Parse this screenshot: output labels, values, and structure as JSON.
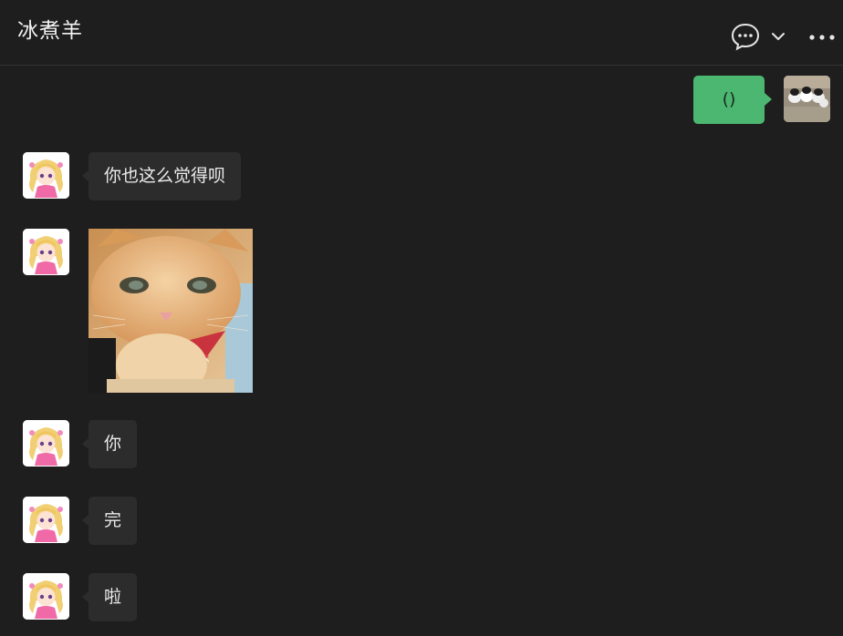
{
  "header": {
    "title": "冰煮羊",
    "icons": [
      "chat-bubble-icon",
      "chevron-down-icon",
      "more-options-icon"
    ]
  },
  "messages": [
    {
      "side": "right",
      "type": "text",
      "text": "()"
    },
    {
      "side": "left",
      "type": "text",
      "text": "你也这么觉得呗"
    },
    {
      "side": "left",
      "type": "image",
      "image": "orange cat with red checkered bowtie"
    },
    {
      "side": "left",
      "type": "text",
      "text": "你"
    },
    {
      "side": "left",
      "type": "text",
      "text": "完"
    },
    {
      "side": "left",
      "type": "text",
      "text": "啦"
    }
  ],
  "colors": {
    "background": "#1e1e1e",
    "bubble_incoming": "#2c2c2c",
    "bubble_outgoing": "#4cb771",
    "text": "#ececec"
  }
}
